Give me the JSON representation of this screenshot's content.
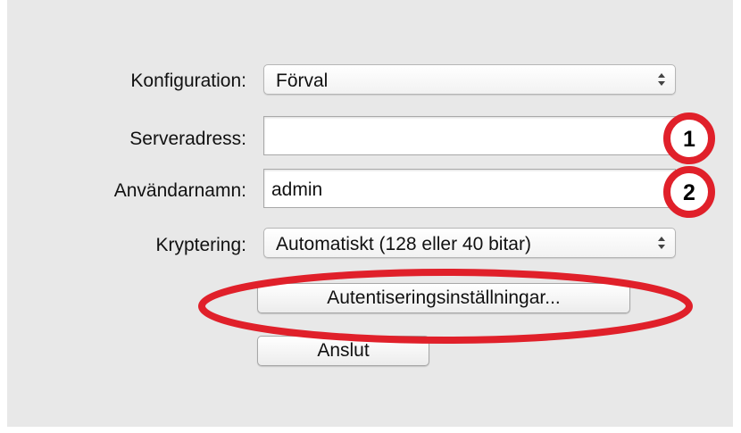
{
  "form": {
    "config": {
      "label": "Konfiguration:",
      "value": "Förval"
    },
    "server": {
      "label": "Serveradress:",
      "value": ""
    },
    "username": {
      "label": "Användarnamn:",
      "value": "admin"
    },
    "encryption": {
      "label": "Kryptering:",
      "value": "Automatiskt (128 eller 40 bitar)"
    },
    "auth_settings_label": "Autentiseringsinställningar...",
    "connect_label": "Anslut"
  },
  "annotations": {
    "marker_1": "1",
    "marker_2": "2",
    "color": "#e0202a"
  }
}
